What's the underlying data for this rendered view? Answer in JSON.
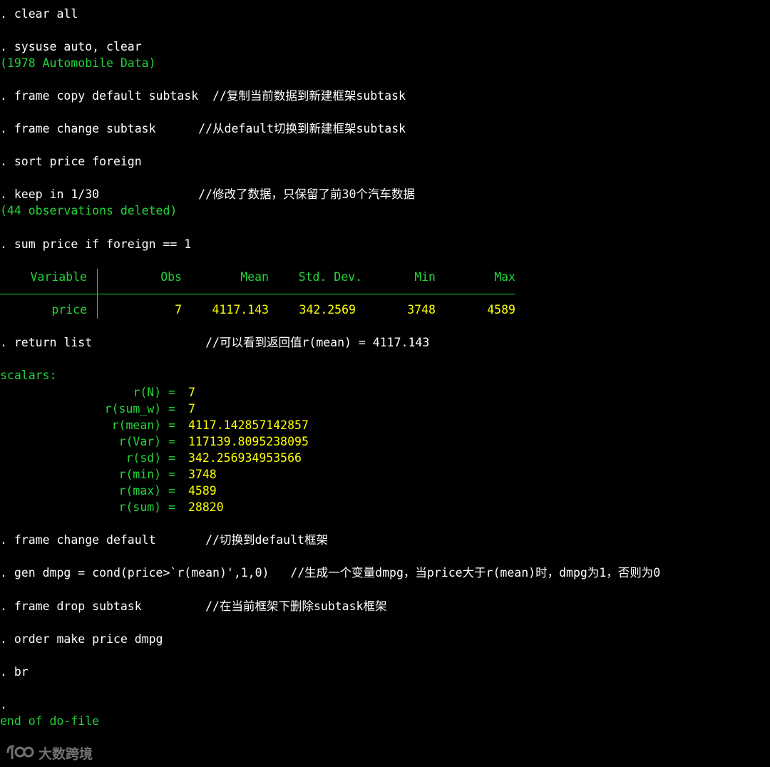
{
  "console": {
    "l1": ". clear all",
    "l2": ". sysuse auto, clear",
    "l3": "(1978 Automobile Data)",
    "l4": ". frame copy default subtask  //复制当前数据到新建框架subtask",
    "l5": ". frame change subtask      //从default切换到新建框架subtask",
    "l6": ". sort price foreign",
    "l7": ". keep in 1/30              //修改了数据，只保留了前30个汽车数据",
    "l8": "(44 observations deleted)",
    "l9": ". sum price if foreign == 1",
    "l10": ". return list                //可以看到返回值r(mean) = 4117.143",
    "l11": "scalars:",
    "l12": ". frame change default       //切换到default框架",
    "l13": ". gen dmpg = cond(price>`r(mean)',1,0)   //生成一个变量dmpg，当price大于r(mean)时，dmpg为1，否则为0",
    "l14": ". frame drop subtask         //在当前框架下删除subtask框架",
    "l15": ". order make price dmpg",
    "l16": ". br",
    "l17": ".",
    "l18": "end of do-file"
  },
  "sum_table": {
    "headers": [
      "Variable",
      "Obs",
      "Mean",
      "Std. Dev.",
      "Min",
      "Max"
    ],
    "row": [
      "price",
      "7",
      "4117.143",
      "342.2569",
      "3748",
      "4589"
    ]
  },
  "scalars": [
    {
      "name": "r(N) =",
      "value": "7"
    },
    {
      "name": "r(sum_w) =",
      "value": "7"
    },
    {
      "name": "r(mean) =",
      "value": "4117.142857142857"
    },
    {
      "name": "r(Var) =",
      "value": "117139.8095238095"
    },
    {
      "name": "r(sd) =",
      "value": "342.256934953566"
    },
    {
      "name": "r(min) =",
      "value": "3748"
    },
    {
      "name": "r(max) =",
      "value": "4589"
    },
    {
      "name": "r(sum) =",
      "value": "28820"
    }
  ],
  "watermark": {
    "text": "大数跨境",
    "icon": "logo-icon"
  },
  "colors": {
    "background": "#000000",
    "command": "#ffffff",
    "result": "#22d43a",
    "value": "#ffff00"
  }
}
